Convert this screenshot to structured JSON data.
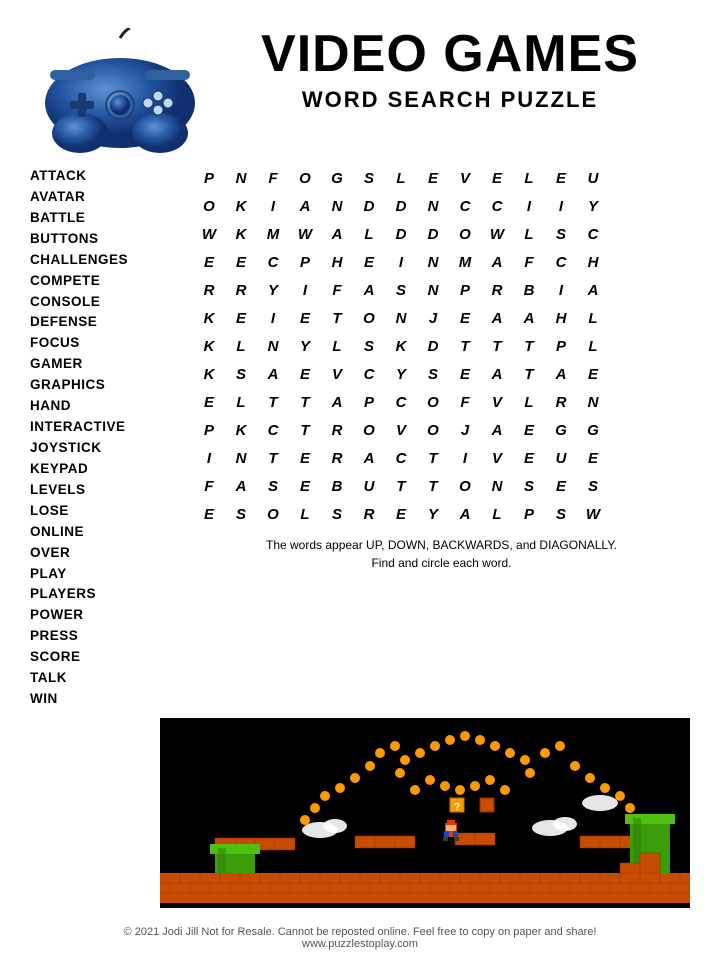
{
  "header": {
    "main_title": "VIDEO GAMES",
    "subtitle": "WORD SEARCH PUZZLE"
  },
  "word_list": [
    "ATTACK",
    "AVATAR",
    "BATTLE",
    "BUTTONS",
    "CHALLENGES",
    "COMPETE",
    "CONSOLE",
    "DEFENSE",
    "FOCUS",
    "GAMER",
    "GRAPHICS",
    "HAND",
    "INTERACTIVE",
    "JOYSTICK",
    "KEYPAD",
    "LEVELS",
    "LOSE",
    "ONLINE",
    "OVER",
    "PLAY",
    "PLAYERS",
    "POWER",
    "PRESS",
    "SCORE",
    "TALK",
    "WIN"
  ],
  "grid": [
    [
      "P",
      "N",
      "F",
      "O",
      "G",
      "S",
      "L",
      "E",
      "V",
      "E",
      "L",
      "E",
      "U"
    ],
    [
      "O",
      "K",
      "I",
      "A",
      "N",
      "D",
      "D",
      "N",
      "C",
      "C",
      "I",
      "I",
      "Y"
    ],
    [
      "W",
      "K",
      "M",
      "W",
      "A",
      "L",
      "D",
      "D",
      "O",
      "W",
      "L",
      "S",
      "C"
    ],
    [
      "E",
      "E",
      "C",
      "P",
      "H",
      "E",
      "I",
      "N",
      "M",
      "A",
      "F",
      "C",
      "H"
    ],
    [
      "R",
      "R",
      "Y",
      "I",
      "F",
      "A",
      "S",
      "N",
      "P",
      "R",
      "B",
      "I",
      "A"
    ],
    [
      "K",
      "E",
      "I",
      "E",
      "T",
      "O",
      "N",
      "J",
      "E",
      "A",
      "A",
      "H",
      "L"
    ],
    [
      "K",
      "L",
      "N",
      "Y",
      "L",
      "S",
      "K",
      "D",
      "T",
      "T",
      "T",
      "P",
      "L"
    ],
    [
      "K",
      "S",
      "A",
      "E",
      "V",
      "C",
      "Y",
      "S",
      "E",
      "A",
      "T",
      "A",
      "E"
    ],
    [
      "E",
      "L",
      "T",
      "T",
      "A",
      "P",
      "C",
      "O",
      "F",
      "V",
      "L",
      "R",
      "N"
    ],
    [
      "P",
      "K",
      "C",
      "T",
      "R",
      "O",
      "V",
      "O",
      "J",
      "A",
      "E",
      "G",
      "G"
    ],
    [
      "I",
      "N",
      "T",
      "E",
      "R",
      "A",
      "C",
      "T",
      "I",
      "V",
      "E",
      "U",
      "E"
    ],
    [
      "F",
      "A",
      "S",
      "E",
      "B",
      "U",
      "T",
      "T",
      "O",
      "N",
      "S",
      "E",
      "S"
    ],
    [
      "E",
      "S",
      "O",
      "L",
      "S",
      "R",
      "E",
      "Y",
      "A",
      "L",
      "P",
      "S",
      "W"
    ]
  ],
  "instructions": {
    "line1": "The words appear UP, DOWN, BACKWARDS, and DIAGONALLY.",
    "line2": "Find and circle each word."
  },
  "footer": {
    "line1": "© 2021  Jodi Jill Not for Resale. Cannot be reposted online. Feel free to copy on paper and share!",
    "line2": "www.puzzlestoplay.com"
  }
}
